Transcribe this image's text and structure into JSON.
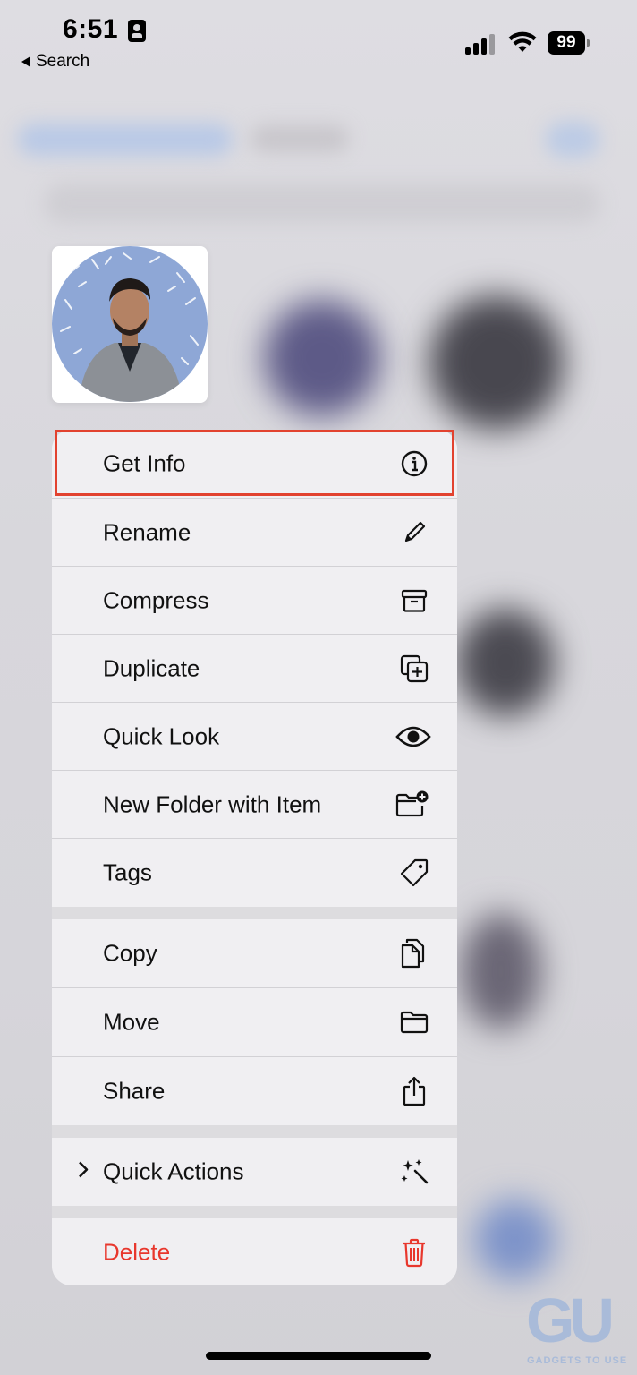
{
  "status_bar": {
    "time": "6:51",
    "back_label": "Search",
    "battery": "99",
    "signal_icon": "cellular-signal-icon",
    "wifi_icon": "wifi-icon"
  },
  "thumbnail": {
    "description_icon": "profile-photo-thumbnail"
  },
  "menu": {
    "items": [
      {
        "label": "Get Info",
        "icon": "info-circle-icon"
      },
      {
        "label": "Rename",
        "icon": "pencil-icon"
      },
      {
        "label": "Compress",
        "icon": "archive-box-icon"
      },
      {
        "label": "Duplicate",
        "icon": "duplicate-plus-icon"
      },
      {
        "label": "Quick Look",
        "icon": "eye-icon"
      },
      {
        "label": "New Folder with Item",
        "icon": "folder-badge-plus-icon"
      },
      {
        "label": "Tags",
        "icon": "tag-icon"
      },
      {
        "label": "Copy",
        "icon": "copy-documents-icon"
      },
      {
        "label": "Move",
        "icon": "folder-icon"
      },
      {
        "label": "Share",
        "icon": "share-icon"
      },
      {
        "label": "Quick Actions",
        "icon": "sparkles-wand-icon"
      },
      {
        "label": "Delete",
        "icon": "trash-icon"
      }
    ],
    "highlight_color": "#e2422f",
    "delete_color": "#e8372d"
  },
  "watermark": {
    "logo": "GU",
    "text": "GADGETS TO USE"
  }
}
